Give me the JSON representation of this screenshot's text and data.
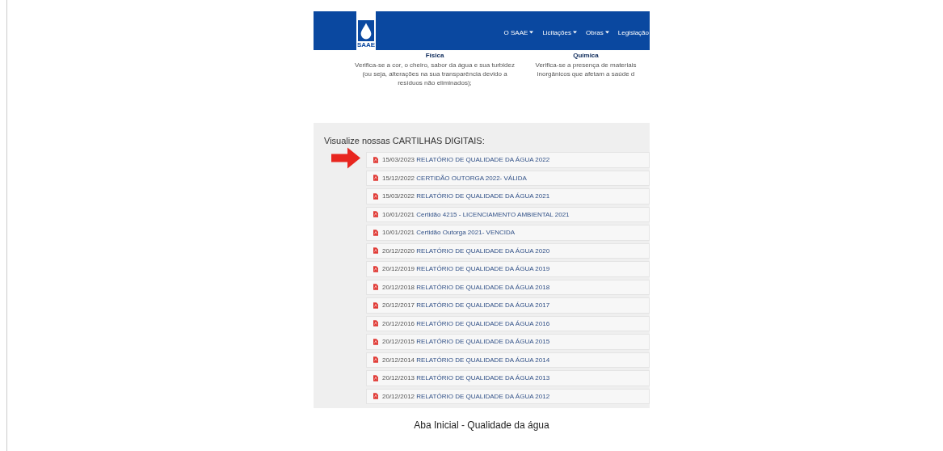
{
  "site": {
    "logo_text": "SAAE",
    "nav": [
      {
        "label": "O SAAE"
      },
      {
        "label": "Licitações"
      },
      {
        "label": "Obras"
      },
      {
        "label": "Legislação"
      }
    ]
  },
  "analysis": [
    {
      "title": "Física",
      "text": "Verifica-se a cor, o cheiro, sabor da água e sua turbidez (ou seja, alterações na sua transparência devido a resíduos não eliminados);"
    },
    {
      "title": "Química",
      "text": "Verifica-se a presença de materiais inorgânicos que afetam a saúde d"
    }
  ],
  "documents": {
    "title": "Visualize nossas CARTILHAS DIGITAIS:",
    "items": [
      {
        "date": "15/03/2023",
        "name": "RELATÓRIO DE QUALIDADE DA ÁGUA 2022",
        "pointed": true
      },
      {
        "date": "15/12/2022",
        "name": "CERTIDÃO OUTORGA 2022- VÁLIDA",
        "pointed": false
      },
      {
        "date": "15/03/2022",
        "name": "RELATÓRIO DE QUALIDADE DA ÁGUA 2021",
        "pointed": false
      },
      {
        "date": "10/01/2021",
        "name": "Certidão 4215 - LICENCIAMENTO AMBIENTAL 2021",
        "pointed": false
      },
      {
        "date": "10/01/2021",
        "name": "Certidão Outorga 2021- VENCIDA",
        "pointed": false
      },
      {
        "date": "20/12/2020",
        "name": "RELATÓRIO DE QUALIDADE DA ÁGUA 2020",
        "pointed": false
      },
      {
        "date": "20/12/2019",
        "name": "RELATÓRIO DE QUALIDADE DA ÁGUA 2019",
        "pointed": false
      },
      {
        "date": "20/12/2018",
        "name": "RELATÓRIO DE QUALIDADE DA ÁGUA 2018",
        "pointed": false
      },
      {
        "date": "20/12/2017",
        "name": "RELATÓRIO DE QUALIDADE DA ÁGUA 2017",
        "pointed": false
      },
      {
        "date": "20/12/2016",
        "name": "RELATÓRIO DE QUALIDADE DA ÁGUA 2016",
        "pointed": false
      },
      {
        "date": "20/12/2015",
        "name": "RELATÓRIO DE QUALIDADE DA ÁGUA 2015",
        "pointed": false
      },
      {
        "date": "20/12/2014",
        "name": "RELATÓRIO DE QUALIDADE DA ÁGUA 2014",
        "pointed": false
      },
      {
        "date": "20/12/2013",
        "name": "RELATÓRIO DE QUALIDADE DA ÁGUA 2013",
        "pointed": false
      },
      {
        "date": "20/12/2012",
        "name": "RELATÓRIO DE QUALIDADE DA ÁGUA 2012",
        "pointed": false
      }
    ]
  },
  "caption": "Aba Inicial - Qualidade da água"
}
